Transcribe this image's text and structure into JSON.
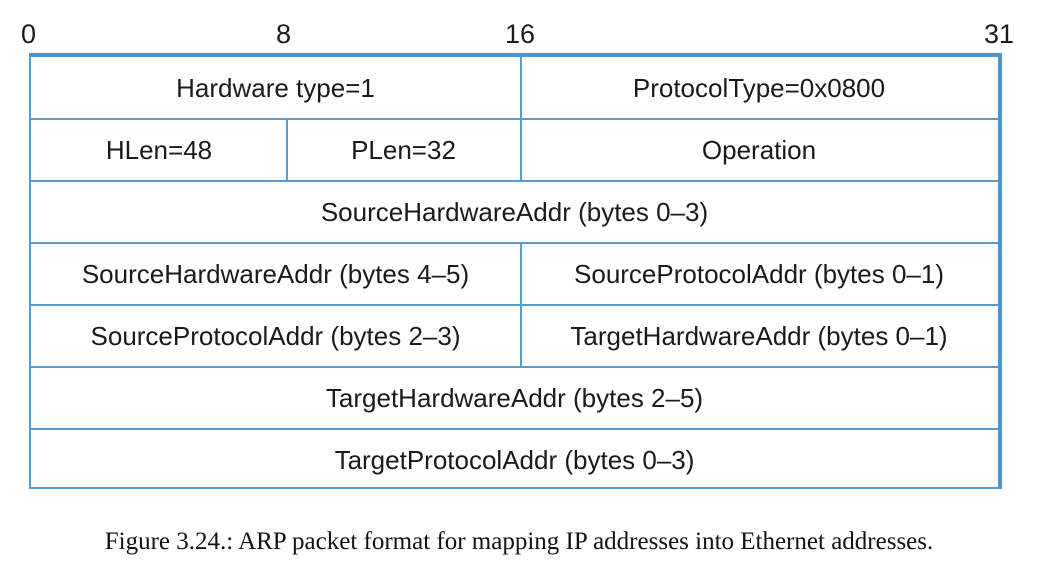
{
  "bit_positions": [
    "0",
    "8",
    "16",
    "31"
  ],
  "rows": [
    {
      "cells": [
        {
          "text": "Hardware type=1"
        },
        {
          "text": "ProtocolType=0x0800"
        }
      ]
    },
    {
      "cells": [
        {
          "text": "HLen=48"
        },
        {
          "text": "PLen=32"
        },
        {
          "text": "Operation"
        }
      ]
    },
    {
      "cells": [
        {
          "text": "SourceHardwareAddr (bytes 0–3)"
        }
      ]
    },
    {
      "cells": [
        {
          "text": "SourceHardwareAddr (bytes 4–5)"
        },
        {
          "text": "SourceProtocolAddr (bytes 0–1)"
        }
      ]
    },
    {
      "cells": [
        {
          "text": "SourceProtocolAddr (bytes 2–3)"
        },
        {
          "text": "TargetHardwareAddr (bytes 0–1)"
        }
      ]
    },
    {
      "cells": [
        {
          "text": "TargetHardwareAddr (bytes 2–5)"
        }
      ]
    },
    {
      "cells": [
        {
          "text": "TargetProtocolAddr (bytes 0–3)"
        }
      ]
    }
  ],
  "caption": "Figure 3.24.: ARP packet format for mapping IP addresses into Ethernet addresses.",
  "colors": {
    "grid_line": "#5a9bd0",
    "outer_border_accent": "#4d94cc",
    "text": "#1a1a1a"
  }
}
